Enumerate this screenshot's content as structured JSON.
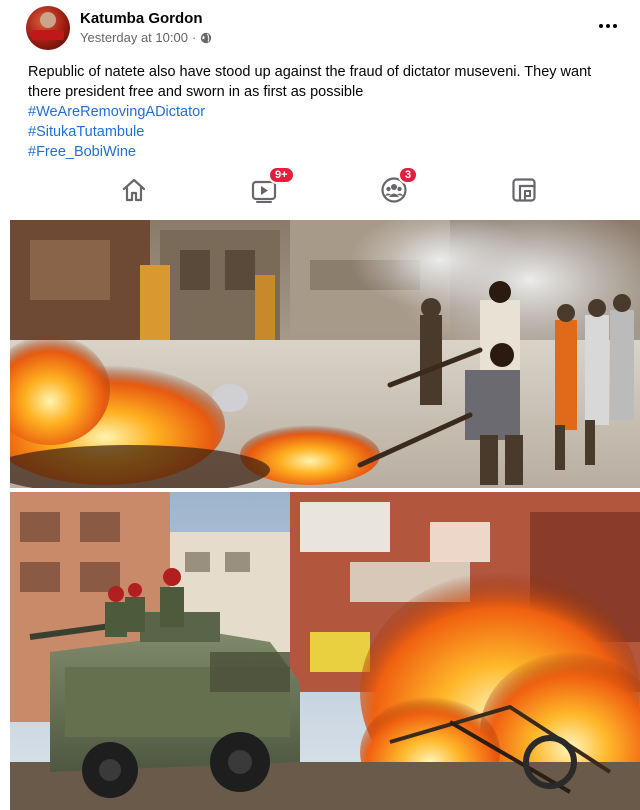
{
  "post": {
    "author": "Katumba Gordon",
    "timestamp": "Yesterday at 10:00",
    "separator": "·",
    "body": "Republic of natete also have stood up against the fraud of dictator museveni. They want there president free and sworn in as first as possible",
    "hashtags": [
      "#WeAreRemovingADictator",
      "#SitukaTutambule",
      "#Free_BobiWine"
    ]
  },
  "nav": {
    "items": [
      {
        "icon": "home-icon"
      },
      {
        "icon": "video-icon",
        "badge": "9+"
      },
      {
        "icon": "groups-icon",
        "badge": "3"
      },
      {
        "icon": "gaming-icon"
      }
    ]
  },
  "colors": {
    "link": "#216fdb",
    "badge": "#e41e3f",
    "secondary_text": "#65676b"
  },
  "photos": [
    {
      "description_icon": "street-riot-photo"
    },
    {
      "description_icon": "armored-vehicle-fire-photo"
    }
  ]
}
